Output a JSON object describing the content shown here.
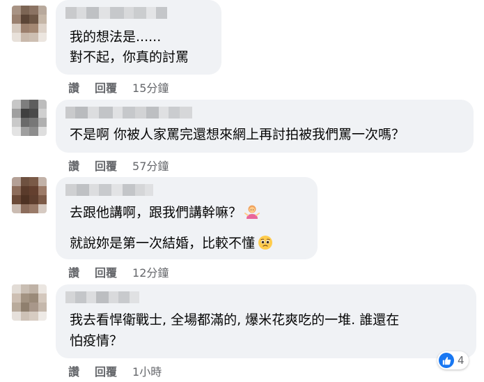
{
  "comments": [
    {
      "lines": [
        "我的想法是......",
        "對不起，你真的討罵"
      ],
      "actions": {
        "like": "讚",
        "reply": "回覆",
        "time": "15分鐘"
      }
    },
    {
      "lines": [
        "不是啊 你被人家罵完還想來網上再討拍被我們罵一次嗎？"
      ],
      "actions": {
        "like": "讚",
        "reply": "回覆",
        "time": "57分鐘"
      }
    },
    {
      "lines": [
        "去跟他講啊，跟我們講幹嘛？",
        "就說妳是第一次結婚，比較不懂"
      ],
      "emojis": [
        "woman-shrugging-emoji",
        "pleading-face-emoji"
      ],
      "actions": {
        "like": "讚",
        "reply": "回覆",
        "time": "12分鐘"
      }
    },
    {
      "lines": [
        "我去看悍衛戰士, 全場都滿的, 爆米花爽吃的一堆. 誰還在",
        "怕疫情？"
      ],
      "actions": {
        "like": "讚",
        "reply": "回覆",
        "time": "1小時"
      },
      "reaction": {
        "icon": "thumbs-up-icon",
        "count": "4"
      }
    }
  ],
  "colors": {
    "bubble": "#f0f2f5",
    "text": "#050505",
    "secondary": "#65676b",
    "like_blue": "#1877f2"
  }
}
